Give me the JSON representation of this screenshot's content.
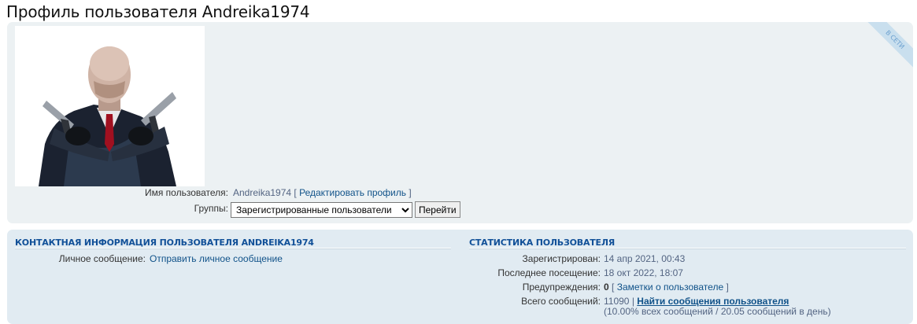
{
  "page": {
    "title": "Профиль пользователя Andreika1974",
    "online_badge": "В СЕТИ"
  },
  "profile": {
    "username_label": "Имя пользователя:",
    "username": "Andreika1974",
    "edit_open": "[",
    "edit_link": "Редактировать профиль",
    "edit_close": "]",
    "groups_label": "Группы:",
    "groups_selected": "Зарегистрированные пользователи",
    "go_button": "Перейти"
  },
  "contact": {
    "heading": "КОНТАКТНАЯ ИНФОРМАЦИЯ ПОЛЬЗОВАТЕЛЯ ANDREIKA1974",
    "pm_label": "Личное сообщение:",
    "pm_link": "Отправить личное сообщение"
  },
  "stats": {
    "heading": "СТАТИСТИКА ПОЛЬЗОВАТЕЛЯ",
    "registered_label": "Зарегистрирован:",
    "registered_value": "14 апр 2021, 00:43",
    "last_visit_label": "Последнее посещение:",
    "last_visit_value": "18 окт 2022, 18:07",
    "warnings_label": "Предупреждения:",
    "warnings_value": "0",
    "notes_open": "[",
    "notes_link": "Заметки о пользователе",
    "notes_close": "]",
    "posts_label": "Всего сообщений:",
    "posts_value": "11090 |",
    "posts_link": "Найти сообщения пользователя",
    "posts_detail": "(10.00% всех сообщений / 20.05 сообщений в день)"
  },
  "colors": {
    "panel_bg": "#ecf1f3",
    "stats_bg": "#e1ebf2",
    "link": "#105289",
    "heading": "#115098"
  }
}
